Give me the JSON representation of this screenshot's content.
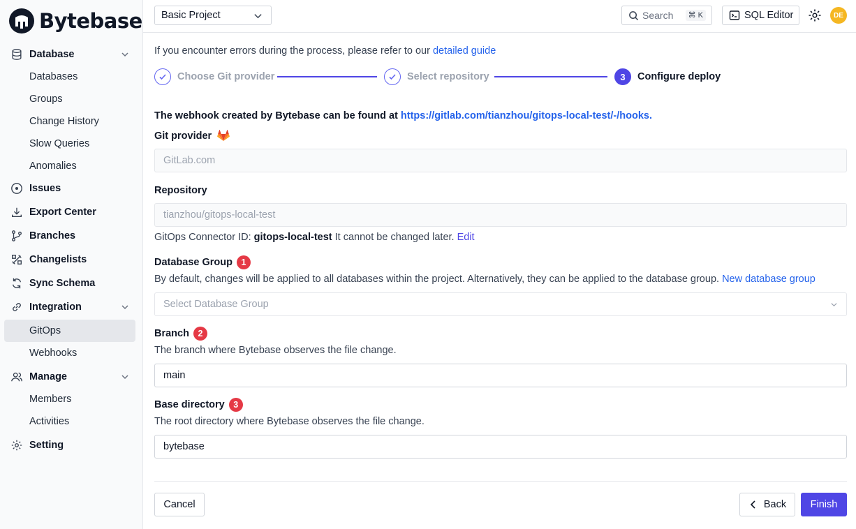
{
  "app": {
    "brand": "Bytebase"
  },
  "sidebar": {
    "database": {
      "label": "Database",
      "items": [
        "Databases",
        "Groups",
        "Change History",
        "Slow Queries",
        "Anomalies"
      ]
    },
    "issues": "Issues",
    "export_center": "Export Center",
    "branches": "Branches",
    "changelists": "Changelists",
    "sync_schema": "Sync Schema",
    "integration": {
      "label": "Integration",
      "items": [
        "GitOps",
        "Webhooks"
      ],
      "active": "GitOps"
    },
    "manage": {
      "label": "Manage",
      "items": [
        "Members",
        "Activities"
      ]
    },
    "setting": "Setting"
  },
  "topbar": {
    "project": "Basic Project",
    "search_placeholder": "Search",
    "search_shortcut": "⌘ K",
    "sql_editor": "SQL Editor",
    "avatar_initials": "DE"
  },
  "guide": {
    "text": "If you encounter errors during the process, please refer to our ",
    "link": "detailed guide"
  },
  "steps": [
    {
      "label": "Choose Git provider",
      "state": "done"
    },
    {
      "label": "Select repository",
      "state": "done"
    },
    {
      "label": "Configure deploy",
      "state": "current",
      "number": "3"
    }
  ],
  "webhook": {
    "text": "The webhook created by Bytebase can be found at ",
    "url": "https://gitlab.com/tianzhou/gitops-local-test/-/hooks",
    "suffix": "."
  },
  "git_provider": {
    "label": "Git provider",
    "value": "GitLab.com"
  },
  "repository": {
    "label": "Repository",
    "value": "tianzhou/gitops-local-test"
  },
  "connector": {
    "prefix": "GitOps Connector ID: ",
    "id": "gitops-local-test",
    "note": " It cannot be changed later. ",
    "edit": "Edit"
  },
  "database_group": {
    "label": "Database Group",
    "badge": "1",
    "desc": "By default, changes will be applied to all databases within the project. Alternatively, they can be applied to the database group. ",
    "link": "New database group",
    "placeholder": "Select Database Group"
  },
  "branch": {
    "label": "Branch",
    "badge": "2",
    "desc": "The branch where Bytebase observes the file change.",
    "value": "main"
  },
  "base_directory": {
    "label": "Base directory",
    "badge": "3",
    "desc": "The root directory where Bytebase observes the file change.",
    "value": "bytebase"
  },
  "footer": {
    "cancel": "Cancel",
    "back": "Back",
    "finish": "Finish"
  },
  "colors": {
    "accent": "#4f46e5",
    "badge": "#e53945",
    "link": "#2563eb",
    "avatar": "#f5b722"
  }
}
